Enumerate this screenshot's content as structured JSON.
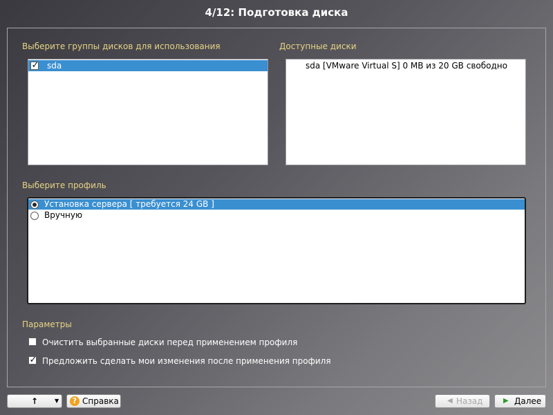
{
  "window": {
    "title": "4/12: Подготовка диска"
  },
  "disk_groups": {
    "label": "Выберите группы дисков для использования",
    "items": [
      {
        "label": "sda",
        "checked": true,
        "selected": true
      }
    ]
  },
  "available_disks": {
    "label": "Доступные диски",
    "items": [
      {
        "label": "sda [VMware Virtual S]  0 MB из 20 GB свободно"
      }
    ]
  },
  "profile": {
    "label": "Выберите профиль",
    "options": [
      {
        "label": "Установка сервера [ требуется 24 GB ]",
        "selected": true
      },
      {
        "label": "Вручную",
        "selected": false
      }
    ]
  },
  "params": {
    "label": "Параметры",
    "options": [
      {
        "label": "Очистить выбранные диски перед применением профиля",
        "checked": false
      },
      {
        "label": "Предложить сделать мои изменения после применения профиля",
        "checked": true
      }
    ]
  },
  "footer": {
    "up_icon": "up-arrow-icon",
    "dropdown_icon": "chevron-down-icon",
    "help_label": "Справка",
    "help_icon": "help-icon",
    "back_label": "Назад",
    "back_icon": "chevron-left-icon",
    "next_label": "Далее",
    "next_icon": "chevron-right-icon"
  },
  "colors": {
    "accent": "#3a8fd0",
    "section_label": "#e8d484",
    "next_arrow": "#2f9a2f"
  }
}
